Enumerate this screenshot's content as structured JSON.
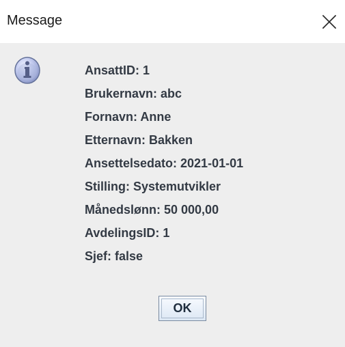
{
  "window": {
    "title": "Message",
    "close_icon": "close-icon"
  },
  "message": {
    "icon": "info-icon",
    "lines": [
      "AnsattID: 1",
      "Brukernavn: abc",
      "Fornavn: Anne",
      "Etternavn: Bakken",
      "Ansettelsedato: 2021-01-01",
      "Stilling: Systemutvikler",
      "Månedslønn: 50 000,00",
      "AvdelingsID: 1",
      "Sjef: false"
    ]
  },
  "buttons": {
    "ok_label": "OK"
  },
  "colors": {
    "window_background": "#eeeeee",
    "titlebar_background": "#ffffff",
    "text": "#333a44",
    "icon_fill": "#aeb8de",
    "icon_stroke": "#65729a"
  }
}
